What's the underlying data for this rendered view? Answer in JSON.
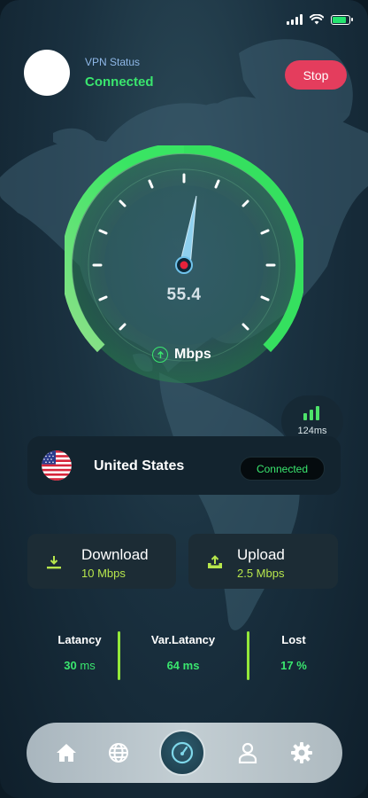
{
  "status_bar": {
    "battery_color": "#25e36f"
  },
  "header": {
    "vpn_status_label": "VPN Status",
    "vpn_status_value": "Connected",
    "stop_label": "Stop"
  },
  "speedometer": {
    "value": "55.4",
    "unit": "Mbps",
    "accent": "#3ae66e"
  },
  "ping": {
    "value": "124ms"
  },
  "country": {
    "name": "United States",
    "status": "Connected"
  },
  "stats": {
    "download": {
      "title": "Download",
      "value": "10 Mbps"
    },
    "upload": {
      "title": "Upload",
      "value": "2.5 Mbps"
    }
  },
  "metrics": {
    "latency": {
      "label": "Latancy",
      "value": "30",
      "unit": "ms"
    },
    "var_latency": {
      "label": "Var.Latancy",
      "value": "64 ms"
    },
    "lost": {
      "label": "Lost",
      "value": "17 %"
    }
  },
  "nav": {
    "items": [
      "home-icon",
      "globe-icon",
      "speedometer-icon",
      "user-icon",
      "settings-icon"
    ]
  }
}
